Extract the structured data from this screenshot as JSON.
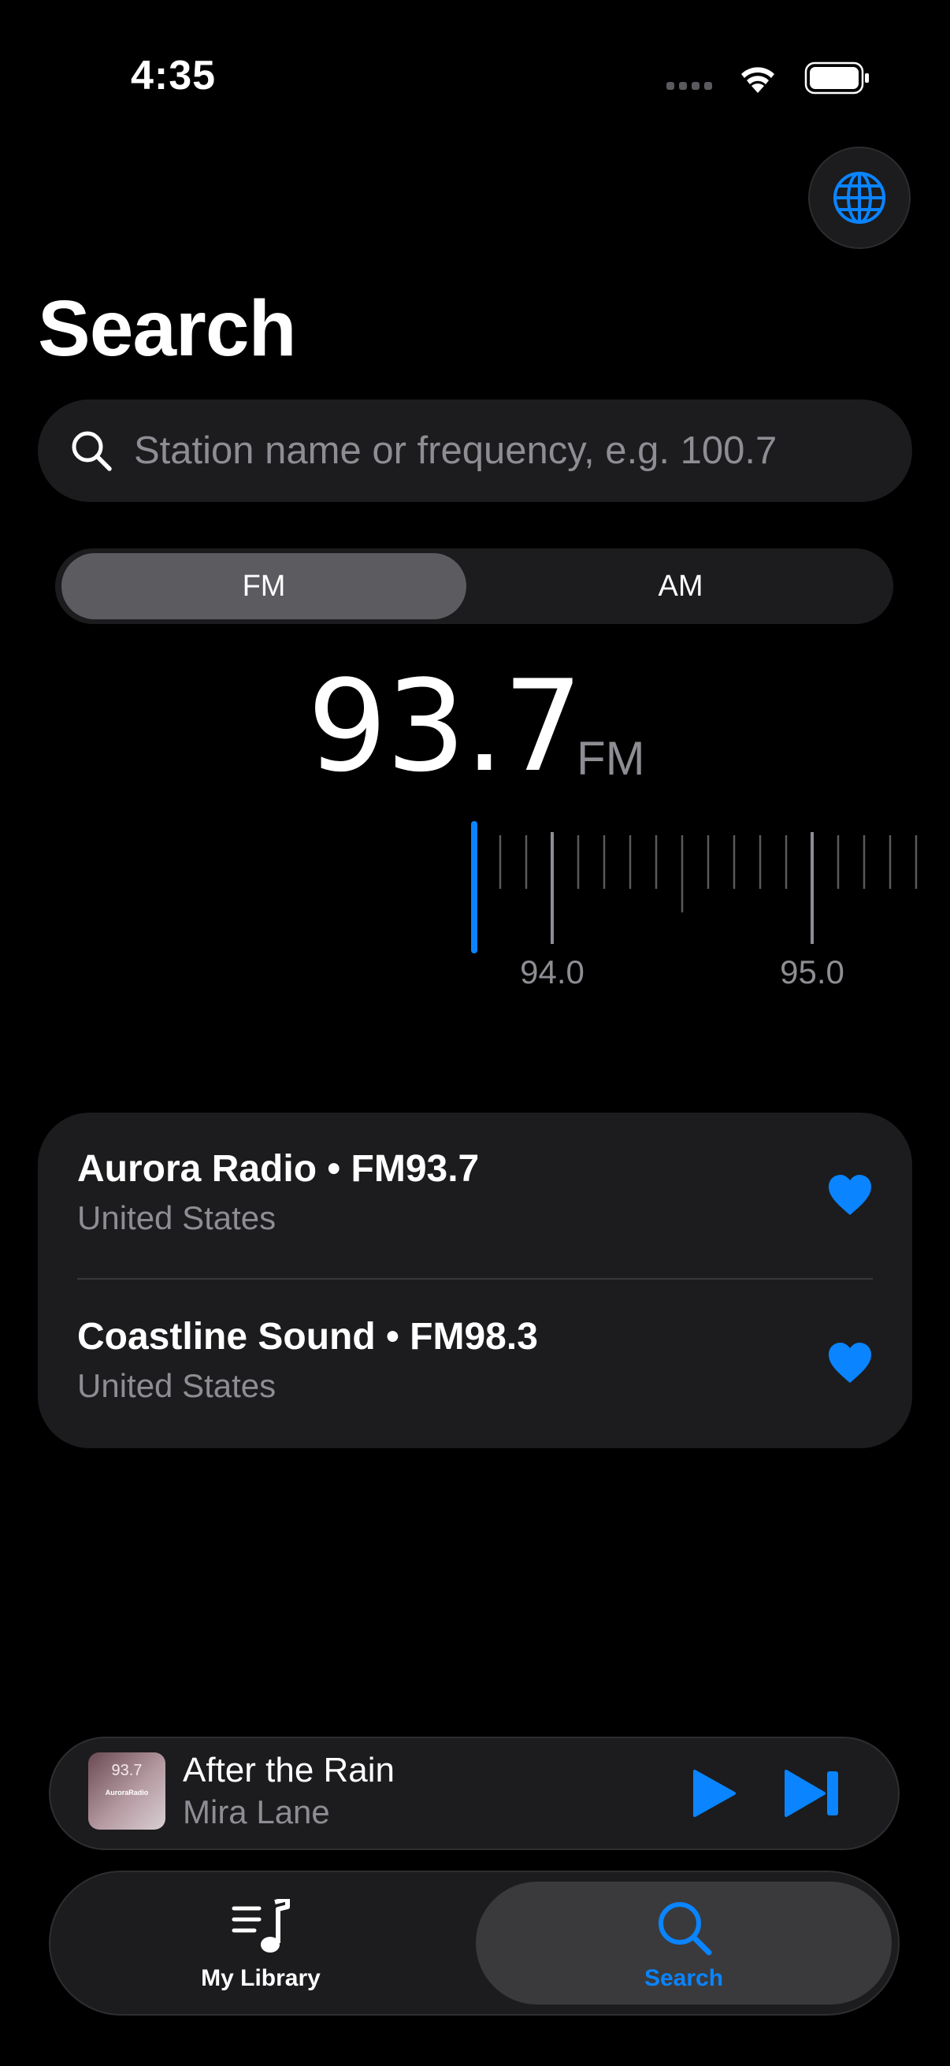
{
  "status_bar": {
    "time": "4:35"
  },
  "header": {
    "title": "Search",
    "globe_icon": "globe-icon"
  },
  "search": {
    "placeholder": "Station name or frequency, e.g. 100.7",
    "value": ""
  },
  "band_selector": {
    "options": [
      "FM",
      "AM"
    ],
    "selected": "FM"
  },
  "tuner": {
    "frequency": "93.7",
    "band": "FM",
    "scale_labels": [
      "94.0",
      "95.0"
    ],
    "accent_color": "#0a84ff"
  },
  "stations": [
    {
      "title": "Aurora Radio • FM93.7",
      "country": "United States",
      "favorite": true
    },
    {
      "title": "Coastline Sound • FM98.3",
      "country": "United States",
      "favorite": true
    }
  ],
  "now_playing": {
    "artwork_text": "93.7",
    "artwork_station": "AuroraRadio",
    "title": "After the Rain",
    "artist": "Mira Lane"
  },
  "tabs": [
    {
      "label": "My Library",
      "icon": "music-library-icon",
      "active": false
    },
    {
      "label": "Search",
      "icon": "search-icon",
      "active": true
    }
  ],
  "colors": {
    "accent": "#0a84ff",
    "background": "#000000",
    "card": "#1c1c1e",
    "secondary_text": "#8d8d93"
  }
}
